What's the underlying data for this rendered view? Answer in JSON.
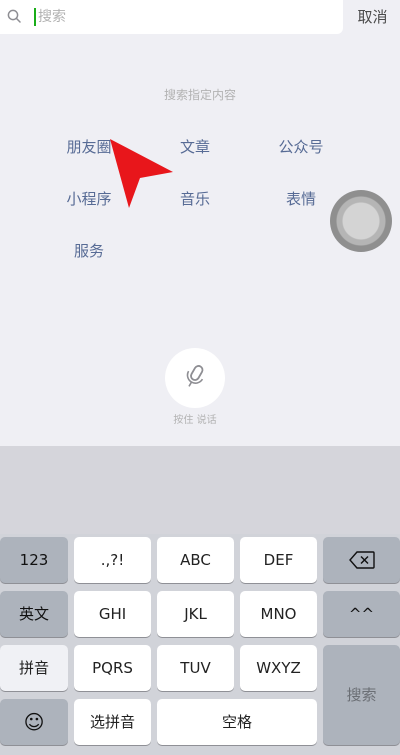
{
  "search": {
    "placeholder": "搜索",
    "cancel_label": "取消"
  },
  "hint": "搜索指定内容",
  "categories": [
    "朋友圈",
    "文章",
    "公众号",
    "小程序",
    "音乐",
    "表情",
    "服务"
  ],
  "voice": {
    "label": "按住 说话"
  },
  "keyboard": {
    "row1": [
      "123",
      ".,?!",
      "ABC",
      "DEF"
    ],
    "row2": [
      "英文",
      "GHI",
      "JKL",
      "MNO",
      "^^"
    ],
    "row3": [
      "拼音",
      "PQRS",
      "TUV",
      "WXYZ"
    ],
    "row4": [
      "选拼音",
      "空格"
    ],
    "search_key": "搜索",
    "emoji_glyph": "☺",
    "delete_icon": "backspace-icon"
  },
  "colors": {
    "link": "#576b95",
    "cursor": "#e8161b",
    "caret": "#1aad19"
  }
}
